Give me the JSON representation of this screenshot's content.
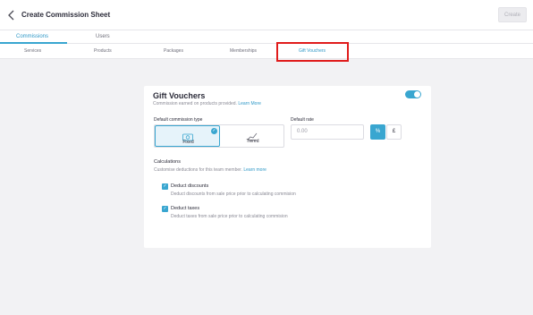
{
  "header": {
    "title": "Create Commission Sheet",
    "create_label": "Create"
  },
  "main_tabs": [
    {
      "label": "Commissions",
      "active": true
    },
    {
      "label": "Users",
      "active": false
    }
  ],
  "sub_tabs": [
    {
      "label": "Services",
      "active": false
    },
    {
      "label": "Products",
      "active": false
    },
    {
      "label": "Packages",
      "active": false
    },
    {
      "label": "Memberships",
      "active": false
    },
    {
      "label": "Gift Vouchers",
      "active": true
    }
  ],
  "card": {
    "title": "Gift Vouchers",
    "subtitle": "Commission earned on products provided.",
    "learn_more": "Learn More",
    "enabled": true,
    "commission_type_label": "Default commission type",
    "types": [
      {
        "label": "Fixed",
        "icon": "cash-icon",
        "selected": true
      },
      {
        "label": "Tiered",
        "icon": "tiered-chart-icon",
        "selected": false
      }
    ],
    "rate_label": "Default rate",
    "rate_placeholder": "0.00",
    "unit_percent": "%",
    "unit_currency": "£",
    "calculations_title": "Calculations",
    "calculations_sub": "Customise deductions for this team member.",
    "calculations_learn_more": "Learn more",
    "deductions": [
      {
        "label": "Deduct discounts",
        "desc": "Deduct discounts from sale price prior to calculating commision",
        "checked": true
      },
      {
        "label": "Deduct taxes",
        "desc": "Deduct taxes from sale price prior to calculating commision",
        "checked": true
      }
    ]
  },
  "colors": {
    "accent": "#39a6d0",
    "highlight": "#e01b1b",
    "background": "#f2f2f4"
  }
}
